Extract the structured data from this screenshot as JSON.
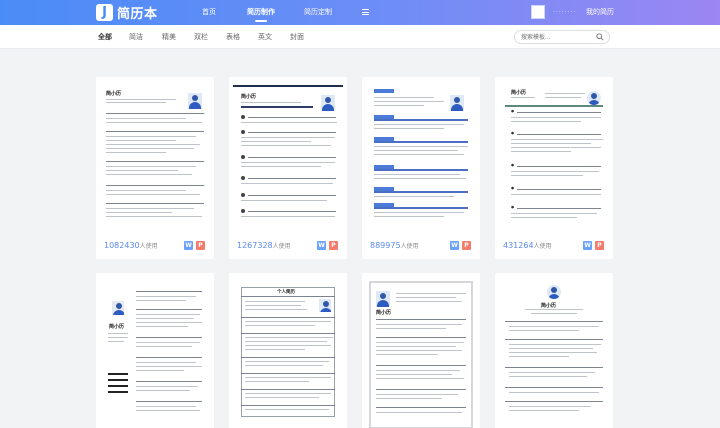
{
  "brand": {
    "logo_letter": "J",
    "name": "简历本"
  },
  "nav": {
    "links": [
      "首页",
      "简历制作",
      "简历定制"
    ],
    "active": "简历制作",
    "username": "········",
    "my_resume": "我的简历"
  },
  "filters": {
    "tabs": [
      "全部",
      "简洁",
      "精美",
      "双栏",
      "表格",
      "英文",
      "封面"
    ],
    "active": "全部",
    "search_placeholder": "搜索模板..."
  },
  "templates": [
    {
      "usage": "1082430",
      "unit": "人使用",
      "name": "简小历"
    },
    {
      "usage": "1267328",
      "unit": "人使用",
      "name": "简小历"
    },
    {
      "usage": "889975",
      "unit": "人使用",
      "name": "简小历"
    },
    {
      "usage": "431264",
      "unit": "人使用",
      "name": "简小历"
    },
    {
      "name": "简小历"
    },
    {
      "title": "个人简历"
    },
    {
      "name": "简小历"
    },
    {
      "name": "简小历"
    }
  ],
  "doc_formats": {
    "word": "W",
    "pdf": "P"
  },
  "colors": {
    "nav_start": "#4a8cf7",
    "nav_end": "#9b86f3",
    "accent": "#5b8af0",
    "word": "#6aa1ff",
    "pdf": "#f47c6c"
  }
}
